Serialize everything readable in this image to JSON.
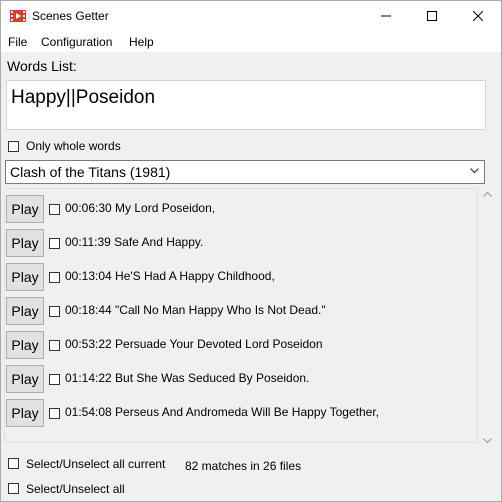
{
  "window": {
    "title": "Scenes Getter",
    "icon": "film-icon"
  },
  "menu": [
    "File",
    "Configuration",
    "Help"
  ],
  "words": {
    "label": "Words List:",
    "value": "Happy||Poseidon"
  },
  "options": {
    "only_whole_words": "Only whole words"
  },
  "movie": {
    "selected": "Clash of the Titans (1981)"
  },
  "results": [
    {
      "button": "Play",
      "text": "00:06:30 My Lord Poseidon,"
    },
    {
      "button": "Play",
      "text": "00:11:39 Safe And Happy."
    },
    {
      "button": "Play",
      "text": "00:13:04 He'S Had A Happy Childhood,"
    },
    {
      "button": "Play",
      "text": "00:18:44 \"Call No Man Happy Who Is Not Dead.\""
    },
    {
      "button": "Play",
      "text": "00:53:22 Persuade Your Devoted Lord Poseidon"
    },
    {
      "button": "Play",
      "text": "01:14:22 But She Was Seduced By Poseidon."
    },
    {
      "button": "Play",
      "text": "01:54:08 Perseus And Andromeda Will Be Happy Together,"
    }
  ],
  "footer": {
    "select_current": "Select/Unselect all current",
    "select_all": "Select/Unselect all",
    "match_count": "82 matches in 26 files"
  }
}
